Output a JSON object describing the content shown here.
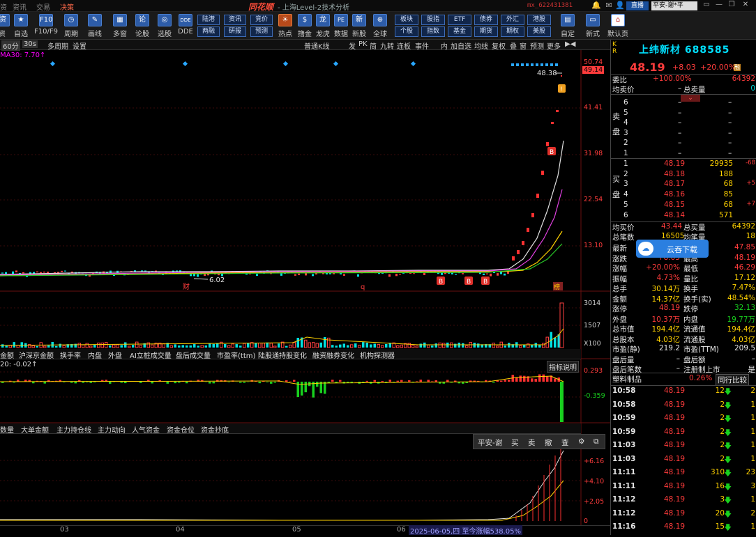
{
  "titlebar": {
    "menus": [
      "资",
      "资讯",
      "交易",
      "决策"
    ],
    "logo": "同花顺",
    "title": "- 上海Level-2技术分析",
    "account": "mx_622431381",
    "live_label": "直播",
    "account_select": "平安-谢*平"
  },
  "toolbar": {
    "buttons": [
      {
        "label": "资",
        "icon": "资"
      },
      {
        "label": "自选",
        "icon": "★"
      },
      {
        "label": "F10/F9",
        "icon": "F10"
      },
      {
        "label": "周期",
        "icon": "◷"
      },
      {
        "label": "画线",
        "icon": "✎"
      },
      {
        "label": "多窗",
        "icon": "▦"
      },
      {
        "label": "论股",
        "icon": "论"
      },
      {
        "label": "选股",
        "icon": "◎"
      },
      {
        "label": "DDE",
        "icon": "DDE"
      }
    ],
    "grid_top": [
      "陆港",
      "资讯",
      "竞价"
    ],
    "grid_bottom": [
      "两融",
      "研报",
      "预测"
    ],
    "buttons2": [
      {
        "label": "热点",
        "icon": "☀"
      },
      {
        "label": "撸金",
        "icon": "$"
      },
      {
        "label": "龙虎",
        "icon": "龙"
      },
      {
        "label": "数据",
        "icon": "PE"
      },
      {
        "label": "新股",
        "icon": "新"
      },
      {
        "label": "全球",
        "icon": "⊕"
      }
    ],
    "grid2_top": [
      "板块",
      "股指",
      "ETF",
      "债券",
      "外汇",
      "港股"
    ],
    "grid2_bottom": [
      "个股",
      "指数",
      "基金",
      "期货",
      "期权",
      "美股"
    ],
    "buttons3": [
      {
        "label": "自定",
        "icon": "▤"
      },
      {
        "label": "新式",
        "icon": "▭"
      },
      {
        "label": "默认页",
        "icon": "⌂"
      }
    ]
  },
  "chartbar": {
    "left": [
      "60分",
      "30s",
      "多周期",
      "设置"
    ],
    "type_select": "普通K线",
    "right": [
      "发",
      "PK",
      "简",
      "九转",
      "连板",
      "事件",
      "内",
      "加自选",
      "均线",
      "复权",
      "叠",
      "窗",
      "预测",
      "更多"
    ]
  },
  "ma30": {
    "label": "MA30:",
    "value": "7.70↑"
  },
  "main_axis": {
    "labels": [
      "50.74",
      "49.14",
      "41.41",
      "31.98",
      "22.54",
      "13.10"
    ]
  },
  "price_notes": {
    "hi": "48.38",
    "lo": "6.02",
    "caifu": "财",
    "q": "q",
    "ting": "榜"
  },
  "vol_axis": {
    "labels": [
      "3014",
      "1507",
      "X100"
    ]
  },
  "tabs1": [
    "金额",
    "沪深京金额",
    "换手率",
    "内盘",
    "外盘",
    "AI立桩成交量",
    "盘后成交量",
    "市盈率(ttm)",
    "陆股通持股变化",
    "融资融券变化",
    "机构探测器"
  ],
  "ind_label": "20: -0.02↑",
  "ind_axis": [
    "0.293",
    "-0.359"
  ],
  "ind_btn": "指标说明",
  "tabs2": [
    "数量",
    "大单金额",
    "主力持仓线",
    "主力动向",
    "人气资金",
    "资金仓位",
    "资金抄底"
  ],
  "flow_axis": [
    "+6.16",
    "+4.10",
    "+2.05",
    "0"
  ],
  "popup": {
    "items": [
      "平安-谢",
      "买",
      "卖",
      "撤",
      "查",
      "⚙",
      "⧉"
    ]
  },
  "dates": {
    "labels": [
      "03",
      "04",
      "05",
      "06",
      "07"
    ],
    "highlight": "2025-06-05,四 至今涨幅538.05%"
  },
  "quote": {
    "kr": "K R",
    "name": "上纬新材 688585",
    "price": "48.19",
    "change": "+8.03",
    "change_pct": "+20.00%",
    "weibi_label": "委比",
    "weibi": "+100.00%",
    "weicha": "64392",
    "avg_sell_label": "均卖价",
    "avg_sell": "–",
    "total_sell_label": "总卖量",
    "total_sell": "0",
    "sell_side": "卖盘",
    "sell_levels": [
      {
        "n": "6",
        "p": "–",
        "v": "–"
      },
      {
        "n": "5",
        "p": "–",
        "v": "–"
      },
      {
        "n": "4",
        "p": "–",
        "v": "–"
      },
      {
        "n": "3",
        "p": "–",
        "v": "–"
      },
      {
        "n": "2",
        "p": "–",
        "v": "–"
      },
      {
        "n": "1",
        "p": "–",
        "v": "–"
      }
    ],
    "buy_side": "买盘",
    "buy_levels": [
      {
        "n": "1",
        "p": "48.19",
        "v": "29935",
        "d": "-68"
      },
      {
        "n": "2",
        "p": "48.18",
        "v": "188",
        "d": ""
      },
      {
        "n": "3",
        "p": "48.17",
        "v": "68",
        "d": "+5"
      },
      {
        "n": "4",
        "p": "48.16",
        "v": "85",
        "d": ""
      },
      {
        "n": "5",
        "p": "48.15",
        "v": "68",
        "d": "+7"
      },
      {
        "n": "6",
        "p": "48.14",
        "v": "571",
        "d": ""
      }
    ],
    "avg_buy_label": "均买价",
    "avg_buy": "43.44",
    "total_buy_label": "总买量",
    "total_buy": "64392",
    "total_trades_label": "总笔数",
    "total_trades": "16505",
    "avg_lot_label": "均笔量",
    "avg_lot": "18",
    "stats": [
      {
        "l1": "最新",
        "v1": "",
        "l2": "开盘",
        "v2": "47.85"
      },
      {
        "l1": "涨跌",
        "v1": "+8.03",
        "l2": "最高",
        "v2": "48.19"
      },
      {
        "l1": "涨幅",
        "v1": "+20.00%",
        "l2": "最低",
        "v2": "46.29"
      },
      {
        "l1": "振幅",
        "v1": "4.73%",
        "l2": "量比",
        "v2": "17.12"
      },
      {
        "l1": "总手",
        "v1": "30.14万",
        "l2": "换手",
        "v2": "7.47%"
      },
      {
        "l1": "金额",
        "v1": "14.37亿",
        "l2": "换手(实)",
        "v2": "48.54%"
      },
      {
        "l1": "涨停",
        "v1": "48.19",
        "l2": "跌停",
        "v2": "32.13"
      },
      {
        "l1": "外盘",
        "v1": "10.37万",
        "l2": "内盘",
        "v2": "19.77万"
      },
      {
        "l1": "总市值",
        "v1": "194.4亿",
        "l2": "流通值",
        "v2": "194.4亿"
      },
      {
        "l1": "总股本",
        "v1": "4.03亿",
        "l2": "流通股",
        "v2": "4.03亿"
      },
      {
        "l1": "市盈(静)",
        "v1": "219.2",
        "l2": "市盈(TTM)",
        "v2": "209.5"
      },
      {
        "l1": "盘后量",
        "v1": "–",
        "l2": "盘后额",
        "v2": "–"
      },
      {
        "l1": "盘后笔数",
        "v1": "–",
        "l2": "注册制上市",
        "v2": "是"
      }
    ],
    "sector": "塑料制品",
    "sector_pct": "0.26%",
    "peer_btn": "同行比较",
    "ticks": [
      {
        "t": "10:58",
        "p": "48.19",
        "v": "12",
        "n": "2"
      },
      {
        "t": "10:58",
        "p": "48.19",
        "v": "2",
        "n": "1"
      },
      {
        "t": "10:59",
        "p": "48.19",
        "v": "2",
        "n": "1"
      },
      {
        "t": "10:59",
        "p": "48.19",
        "v": "2",
        "n": "1"
      },
      {
        "t": "11:03",
        "p": "48.19",
        "v": "2",
        "n": "1"
      },
      {
        "t": "11:03",
        "p": "48.19",
        "v": "2",
        "n": "1"
      },
      {
        "t": "11:11",
        "p": "48.19",
        "v": "310",
        "n": "23"
      },
      {
        "t": "11:11",
        "p": "48.19",
        "v": "16",
        "n": "3"
      },
      {
        "t": "11:12",
        "p": "48.19",
        "v": "3",
        "n": "1"
      },
      {
        "t": "11:12",
        "p": "48.19",
        "v": "20",
        "n": "2"
      },
      {
        "t": "11:16",
        "p": "48.19",
        "v": "15",
        "n": "1"
      }
    ]
  },
  "yun": {
    "label": "云吞下载"
  }
}
